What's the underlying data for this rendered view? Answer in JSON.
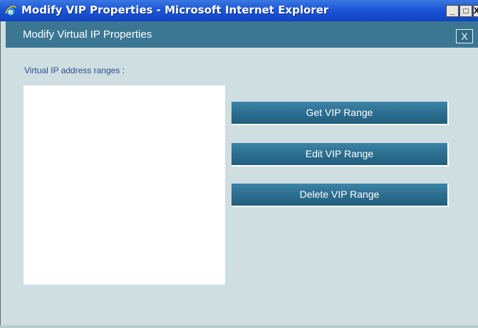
{
  "window": {
    "title": "Modify VIP Properties - Microsoft Internet Explorer",
    "icon": "internet-explorer-icon",
    "controls": {
      "minimize": "_",
      "maximize": "□",
      "close": "X"
    }
  },
  "dialog": {
    "title": "Modify Virtual IP Properties",
    "close_label": "X",
    "range_label": "Virtual IP address ranges :",
    "buttons": {
      "get": "Get VIP Range",
      "edit": "Edit VIP Range",
      "delete": "Delete VIP Range"
    }
  },
  "colors": {
    "header": "#3b7793",
    "background": "#cfdee0",
    "button": "#2c6e90",
    "label": "#2a4f95"
  }
}
